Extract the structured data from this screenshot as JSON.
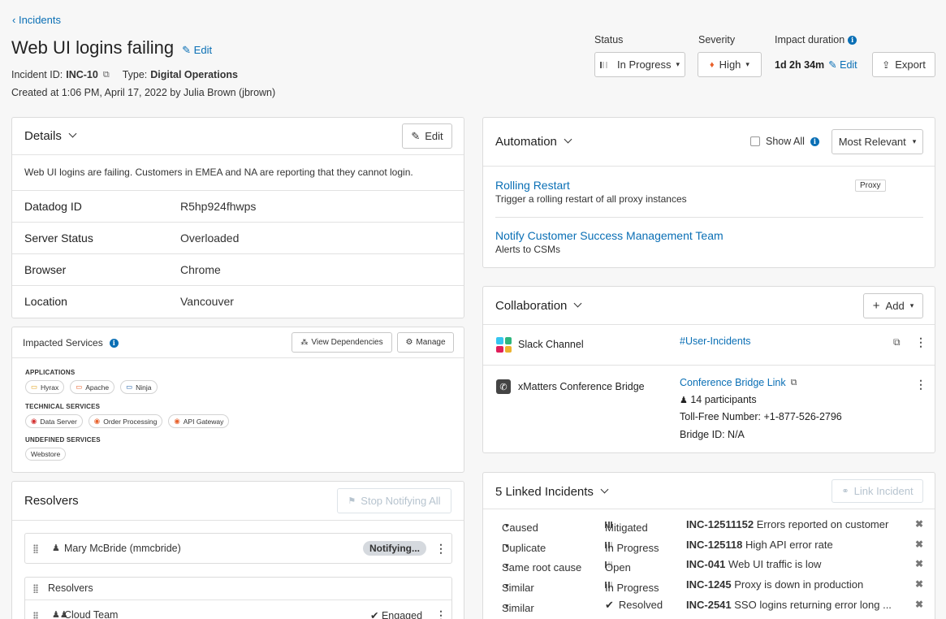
{
  "breadcrumb": "Incidents",
  "title": "Web UI logins failing",
  "title_edit": "Edit",
  "incident_id_label": "Incident ID:",
  "incident_id": "INC-10",
  "type_label": "Type:",
  "type_value": "Digital Operations",
  "created": "Created at 1:06 PM, April 17, 2022 by Julia Brown (jbrown)",
  "status": {
    "label": "Status",
    "value": "In Progress"
  },
  "severity": {
    "label": "Severity",
    "value": "High"
  },
  "impact": {
    "label": "Impact duration",
    "value": "1d 2h 34m",
    "edit": "Edit"
  },
  "export_label": "Export",
  "details": {
    "title": "Details",
    "edit": "Edit",
    "description": "Web UI logins are failing. Customers in EMEA and NA are reporting that they cannot login.",
    "rows": [
      {
        "label": "Datadog ID",
        "value": "R5hp924fhwps"
      },
      {
        "label": "Server Status",
        "value": "Overloaded"
      },
      {
        "label": "Browser",
        "value": "Chrome"
      },
      {
        "label": "Location",
        "value": "Vancouver"
      }
    ]
  },
  "impacted": {
    "title": "Impacted Services",
    "view_deps": "View Dependencies",
    "manage": "Manage",
    "applications_title": "APPLICATIONS",
    "applications": [
      "Hyrax",
      "Apache",
      "Ninja"
    ],
    "technical_title": "TECHNICAL SERVICES",
    "technical": [
      "Data Server",
      "Order Processing",
      "API Gateway"
    ],
    "undefined_title": "UNDEFINED SERVICES",
    "undefined": [
      "Webstore"
    ]
  },
  "resolvers": {
    "title": "Resolvers",
    "stop": "Stop Notifying All",
    "person": "Mary McBride (mmcbride)",
    "person_status": "Notifying...",
    "group_title": "Resolvers",
    "team": "Cloud Team",
    "team_status": "Engaged"
  },
  "automation": {
    "title": "Automation",
    "show_all": "Show All",
    "sort": "Most Relevant",
    "items": [
      {
        "name": "Rolling Restart",
        "desc": "Trigger a rolling restart of all proxy instances",
        "tag": "Proxy"
      },
      {
        "name": "Notify Customer Success Management Team",
        "desc": "Alerts to CSMs",
        "tag": ""
      }
    ]
  },
  "collaboration": {
    "title": "Collaboration",
    "add": "Add",
    "slack_label": "Slack Channel",
    "slack_link": "#User-Incidents",
    "bridge_label": "xMatters Conference Bridge",
    "bridge_link": "Conference Bridge Link",
    "participants": "14 participants",
    "toll_free": "Toll-Free Number: +1-877-526-2796",
    "bridge_id": "Bridge ID: N/A"
  },
  "linked": {
    "title": "5 Linked Incidents",
    "link_btn": "Link Incident",
    "rows": [
      {
        "rel": "Caused",
        "status": "Mitigated",
        "id": "INC-12511152",
        "text": "Errors reported on customer"
      },
      {
        "rel": "Duplicate",
        "status": "In Progress",
        "id": "INC-125118",
        "text": "High API error rate"
      },
      {
        "rel": "Same root cause",
        "status": "Open",
        "id": "INC-041",
        "text": "Web UI traffic is low"
      },
      {
        "rel": "Similar",
        "status": "In Progress",
        "id": "INC-1245",
        "text": "Proxy is down in production"
      },
      {
        "rel": "Similar",
        "status": "Resolved",
        "id": "INC-2541",
        "text": "SSO logins returning error long ..."
      }
    ]
  }
}
